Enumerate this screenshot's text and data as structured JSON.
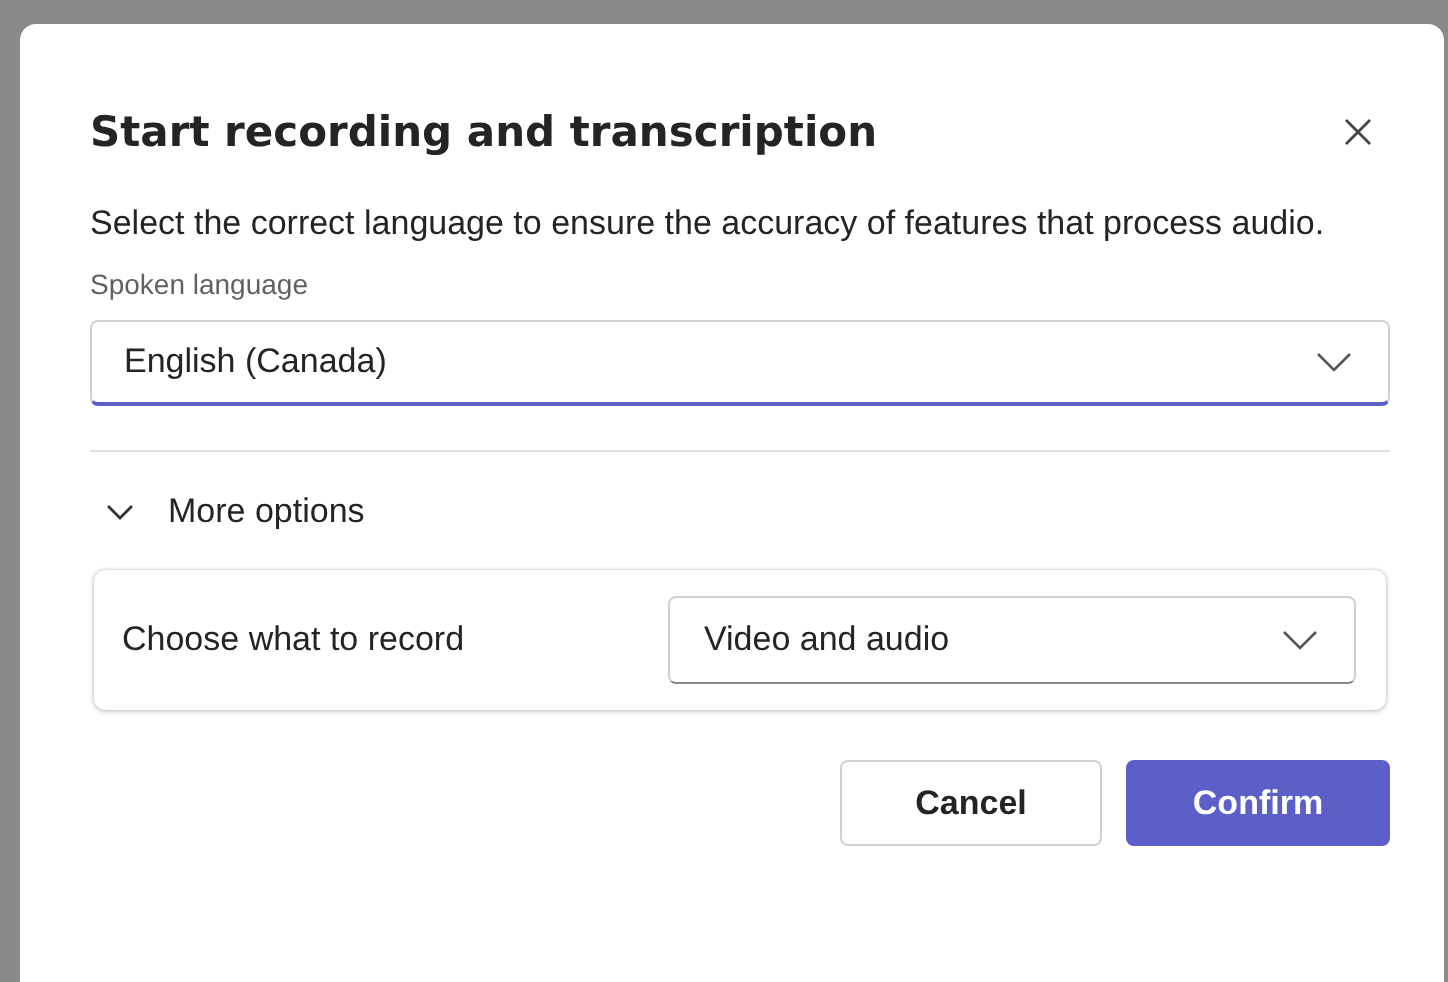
{
  "dialog": {
    "title": "Start recording and transcription",
    "description": "Select the correct language to ensure the accuracy of features that process audio.",
    "spoken_language": {
      "label": "Spoken language",
      "value": "English (Canada)"
    },
    "more_options": {
      "label": "More options",
      "expanded": true,
      "record_label": "Choose what to record",
      "record_value": "Video and audio"
    },
    "buttons": [
      {
        "label": "Cancel",
        "kind": "secondary"
      },
      {
        "label": "Confirm",
        "kind": "primary"
      }
    ]
  }
}
